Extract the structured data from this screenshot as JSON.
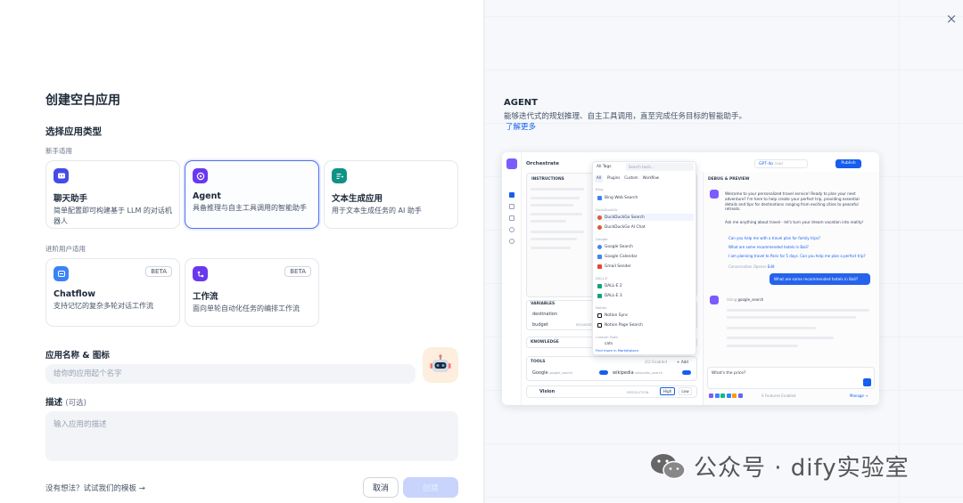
{
  "dialog": {
    "title": "创建空白应用",
    "close_icon": "×"
  },
  "type_section": {
    "heading": "选择应用类型",
    "beginner_label": "新手适用",
    "advanced_label": "进阶用户适用",
    "cards": [
      {
        "name": "聊天助手",
        "desc": "简单配置即可构建基于 LLM 的对话机器人",
        "color": "#444ce7",
        "icon": "chat-icon"
      },
      {
        "name": "Agent",
        "desc": "具备推理与自主工具调用的智能助手",
        "color": "#6938ef",
        "icon": "robot-icon"
      },
      {
        "name": "文本生成应用",
        "desc": "用于文本生成任务的 AI 助手",
        "color": "#0e9384",
        "icon": "text-generate-icon"
      },
      {
        "name": "Chatflow",
        "desc": "支持记忆的复杂多轮对话工作流",
        "color": "#3b82f6",
        "icon": "chatflow-icon",
        "badge": "BETA"
      },
      {
        "name": "工作流",
        "desc": "面向单轮自动化任务的编排工作流",
        "color": "#6938ef",
        "icon": "workflow-icon",
        "badge": "BETA"
      }
    ]
  },
  "name_section": {
    "label": "应用名称 & 图标",
    "placeholder": "给你的应用起个名字"
  },
  "desc_section": {
    "label": "描述",
    "optional": "(可选)",
    "placeholder": "输入应用的描述"
  },
  "footer": {
    "template_link": "没有想法？试试我们的模板 →",
    "cancel": "取消",
    "create": "创建"
  },
  "preview": {
    "heading": "AGENT",
    "desc": "能够迭代式的规划推理、自主工具调用，直至完成任务目标的智能助手。",
    "link": "了解更多",
    "shot": {
      "orchestrate": "Orchestrate",
      "model": "GPT-4o",
      "chat_badge": "CHAT",
      "publish": "Publish",
      "instructions": "INSTRUCTIONS",
      "variables": "VARIABLES",
      "var1": "destination",
      "var2": "budget",
      "required": "REQUIRED",
      "knowledge": "KNOWLEDGE",
      "tools": "TOOLS",
      "tools_enabled": "2/2 Enabled",
      "add": "+ Add",
      "tool1": "Google",
      "tool1_id": "google_search",
      "tool2": "wikipedia",
      "tool2_id": "wikipedia_search",
      "vision": "Vision",
      "resolution": "RESOLUTION",
      "high": "High",
      "low": "Low",
      "all_tags": "All Tags",
      "search": "Search tools...",
      "tabs": [
        "All",
        "Plugins",
        "Custom",
        "Workflow"
      ],
      "groups": [
        {
          "g": "Bing",
          "items": [
            "Bing Web Search"
          ]
        },
        {
          "g": "DuckDuckGo",
          "items": [
            "DuckDuckGo Search",
            "DuckDuckGo AI Chat"
          ]
        },
        {
          "g": "Google",
          "items": [
            "Google Search",
            "Google Calendar",
            "Gmail Sender"
          ]
        },
        {
          "g": "DALL-E",
          "items": [
            "DALL-E 2",
            "DALL-E 3"
          ]
        },
        {
          "g": "Notion",
          "items": [
            "Notion Sync",
            "Notion Page Search"
          ]
        },
        {
          "g": "Custom Tools",
          "items": [
            "cats"
          ]
        }
      ],
      "marketplace": "Find more in Marketplace",
      "debug": "DEBUG & PREVIEW",
      "welcome1": "Welcome to your personalized travel service! Ready to plan your next adventure? I'm here to help create your perfect trip, providing essential details and tips for destinations ranging from exciting cities to peaceful retreats.",
      "welcome2": "Ask me anything about travel - let's turn your dream vacation into reality!",
      "s1": "Can you help me with a travel plan for family trips?",
      "s2": "What are some recommended hotels in Bali?",
      "s3": "I am planning travel to Paris for 5 days. Can you help me plan a perfect trip?",
      "opener": "Conversation Opener",
      "edit": "Edit",
      "user_msg": "What are some recommended hotels in Bali?",
      "using": "Using",
      "using_tool": "google_search",
      "input": "What's the price?",
      "features": "6 Features Enabled",
      "manage": "Manage →"
    }
  },
  "watermark": "公众号 · dify实验室"
}
